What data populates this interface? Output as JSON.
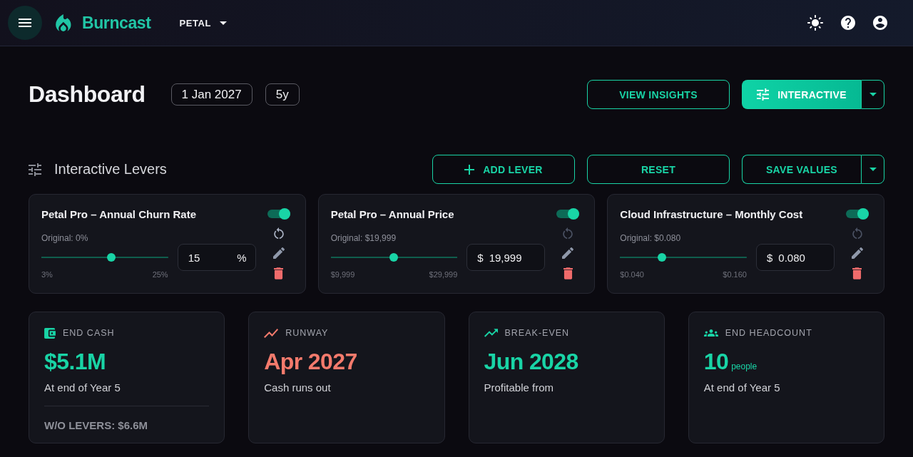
{
  "app_bar": {
    "brand": "Burncast",
    "company": "PETAL"
  },
  "header": {
    "title": "Dashboard",
    "date": "1 Jan 2027",
    "horizon": "5y",
    "buttons": [
      {
        "label": "VIEW INSIGHTS",
        "kind": "outline"
      },
      {
        "label": "INTERACTIVE",
        "kind": "split_filled"
      }
    ]
  },
  "levers_panel": {
    "title": "Interactive Levers",
    "buttons": [
      {
        "label": "ADD LEVER",
        "kind": "add"
      },
      {
        "label": "RESET",
        "kind": "outline"
      },
      {
        "label": "SAVE VALUES",
        "kind": "split"
      }
    ]
  },
  "levers": [
    {
      "name": "Petal Pro – Annual Churn Rate",
      "enabled": true,
      "original": "Original: 0%",
      "level": 0.55,
      "min": "3%",
      "max": "25%",
      "value": "15",
      "suffix": "%",
      "reset_disabled": false
    },
    {
      "name": "Petal Pro – Annual Price",
      "enabled": true,
      "original": "Original: $19,999",
      "level": 0.5,
      "min": "$9,999",
      "max": "$29,999",
      "prefix": "$",
      "value": "19,999",
      "reset_disabled": true
    },
    {
      "name": "Cloud Infrastructure – Monthly Cost",
      "enabled": true,
      "original": "Original: $0.080",
      "level": 0.333,
      "min": "$0.040",
      "max": "$0.160",
      "prefix": "$",
      "value": "0.080",
      "reset_disabled": true
    }
  ],
  "metrics": [
    {
      "label": "END CASH",
      "value": "$5.1M",
      "color": "#19d4a6",
      "caption": "At end of Year 5",
      "footer": "W/O LEVERS: $6.6M"
    },
    {
      "label": "RUNWAY",
      "value": "Apr 2027",
      "color": "#f47a6c",
      "caption": "Cash runs out"
    },
    {
      "label": "BREAK-EVEN",
      "value": "Jun 2028",
      "color": "#19d4a6",
      "caption": "Profitable from"
    },
    {
      "label": "END HEADCOUNT",
      "value": "10",
      "unit": "people",
      "color": "#19d4a6",
      "caption": "At end of Year 5"
    }
  ]
}
